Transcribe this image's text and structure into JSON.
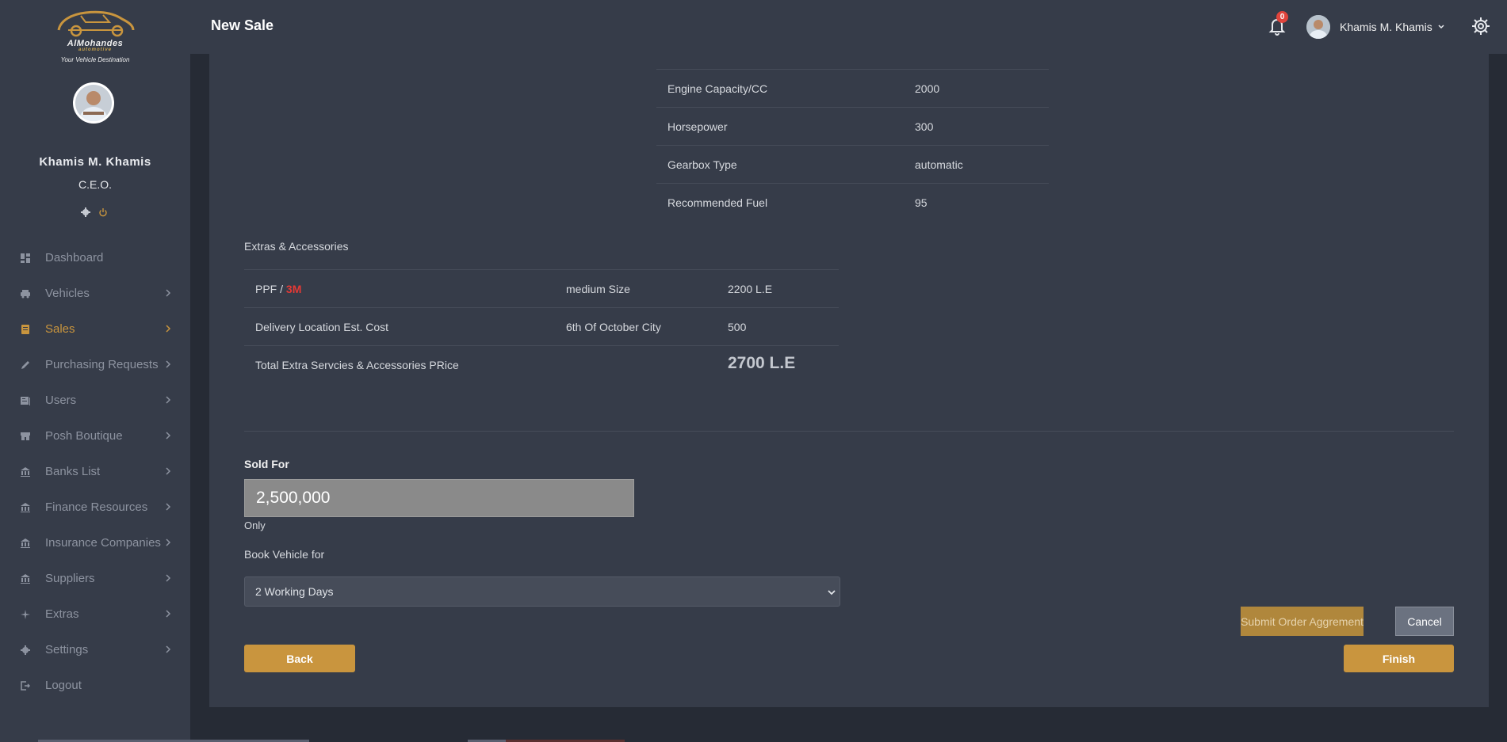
{
  "brand": {
    "name": "AlMohandes",
    "sub": "automotive",
    "tagline": "Your Vehicle Destination"
  },
  "profile": {
    "name": "Khamis M. Khamis",
    "role": "C.E.O."
  },
  "nav": {
    "items": [
      {
        "label": "Dashboard",
        "icon": "dashboard-icon",
        "has_chevron": false,
        "active": false
      },
      {
        "label": "Vehicles",
        "icon": "car-icon",
        "has_chevron": true,
        "active": false
      },
      {
        "label": "Sales",
        "icon": "sales-icon",
        "has_chevron": true,
        "active": true
      },
      {
        "label": "Purchasing Requests",
        "icon": "edit-icon",
        "has_chevron": true,
        "active": false
      },
      {
        "label": "Users",
        "icon": "users-icon",
        "has_chevron": true,
        "active": false
      },
      {
        "label": "Posh Boutique",
        "icon": "store-icon",
        "has_chevron": true,
        "active": false
      },
      {
        "label": "Banks List",
        "icon": "bank-icon",
        "has_chevron": true,
        "active": false
      },
      {
        "label": "Finance Resources",
        "icon": "bank-icon",
        "has_chevron": true,
        "active": false
      },
      {
        "label": "Insurance Companies",
        "icon": "bank-icon",
        "has_chevron": true,
        "active": false
      },
      {
        "label": "Suppliers",
        "icon": "bank-icon",
        "has_chevron": true,
        "active": false
      },
      {
        "label": "Extras",
        "icon": "sparkle-icon",
        "has_chevron": true,
        "active": false
      },
      {
        "label": "Settings",
        "icon": "gear-icon",
        "has_chevron": true,
        "active": false
      },
      {
        "label": "Logout",
        "icon": "logout-icon",
        "has_chevron": false,
        "active": false
      }
    ]
  },
  "header": {
    "title": "New Sale",
    "notification_count": "0",
    "user_name": "Khamis M. Khamis"
  },
  "specs": {
    "rows": [
      {
        "label": "Engine Capacity/CC",
        "value": "2000"
      },
      {
        "label": "Horsepower",
        "value": "300"
      },
      {
        "label": "Gearbox Type",
        "value": "automatic"
      },
      {
        "label": "Recommended Fuel",
        "value": "95"
      }
    ]
  },
  "extras": {
    "title": "Extras & Accessories",
    "rows": [
      {
        "item": "PPF / ",
        "item_accent": "3M",
        "detail": "medium Size",
        "price": "2200 L.E"
      },
      {
        "item": "Delivery Location Est. Cost",
        "item_accent": "",
        "detail": "6th Of October City",
        "price": "500"
      }
    ],
    "total_label": "Total Extra Servcies & Accessories PRice",
    "total_value": "2700 L.E"
  },
  "sale": {
    "sold_for_label": "Sold For",
    "sold_for_value": "2,500,000",
    "only_label": "Only",
    "book_label": "Book Vehicle for",
    "book_selected": "2 Working Days"
  },
  "buttons": {
    "submit": "Submit Order Aggrement",
    "cancel": "Cancel",
    "back": "Back",
    "finish": "Finish"
  },
  "colors": {
    "accent": "#c9953e",
    "badge": "#e0443c",
    "accent_text": "#e53935"
  }
}
